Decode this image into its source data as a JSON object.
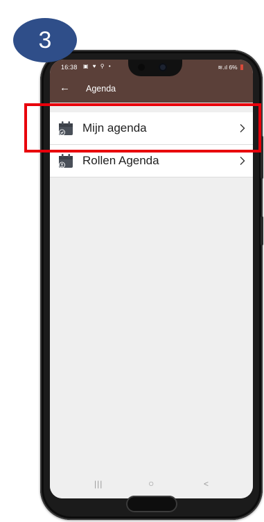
{
  "step_badge": "3",
  "status_bar": {
    "time": "16:38",
    "notification_icons": "▣ ♥ ⚲ •",
    "signal": "≋.ıl",
    "battery_percent": "6%"
  },
  "app_bar": {
    "back_glyph": "←",
    "title": "Agenda"
  },
  "menu": {
    "items": [
      {
        "label": "Mijn agenda",
        "icon": "calendar-check-icon",
        "chevron": "chevron-right-icon"
      },
      {
        "label": "Rollen Agenda",
        "icon": "calendar-user-icon",
        "chevron": "chevron-right-icon"
      }
    ]
  },
  "nav_bar": {
    "recents_glyph": "|||",
    "home_glyph": "○",
    "back_glyph": "<"
  },
  "colors": {
    "app_bar": "#5b4039",
    "highlight": "#e8000b",
    "badge": "#2f4e89",
    "icon": "#4a5059"
  }
}
